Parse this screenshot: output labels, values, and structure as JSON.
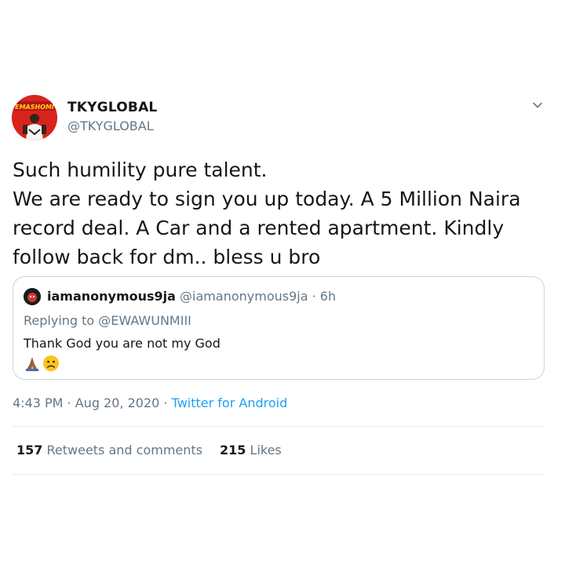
{
  "tweet": {
    "author": {
      "display_name": "TKYGLOBAL",
      "handle": "@TKYGLOBAL",
      "avatar_text": "EMASHOMI",
      "avatar_icon": "profile-avatar"
    },
    "menu_icon": "chevron-down-icon",
    "text_lines": [
      "Such humility pure talent.",
      "We are ready to sign you up today. A 5 Million Naira",
      "record deal. A Car and a rented apartment. Kindly",
      "follow back for dm.. bless u bro"
    ],
    "quoted_tweet": {
      "display_name": "iamanonymous9ja",
      "handle": "@iamanonymous9ja",
      "separator": " · ",
      "age": "6h",
      "replying_to_label": "Replying to",
      "replying_to_handle": "@EWAWUNMIII",
      "text": "Thank God you are not my God",
      "emojis": [
        "folded-hands-icon",
        "slightly-frowning-face-icon"
      ]
    },
    "timestamp": {
      "time": "4:43 PM",
      "separator": " · ",
      "date": "Aug 20, 2020",
      "separator2": " · ",
      "source": "Twitter for Android"
    },
    "stats": {
      "retweets_count": "157",
      "retweets_label": "Retweets and comments",
      "likes_count": "215",
      "likes_label": "Likes"
    },
    "colors": {
      "link": "#1da1f2",
      "muted": "#657786",
      "text": "#14171a",
      "border": "#ccd6dd",
      "divider": "#e6ecf0"
    }
  }
}
